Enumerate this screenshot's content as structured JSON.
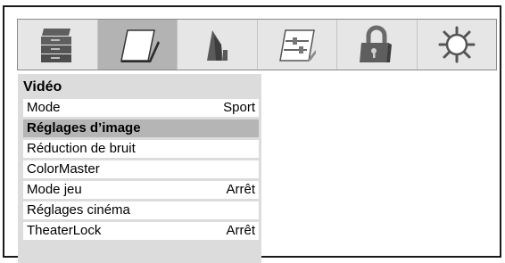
{
  "icon_bar": {
    "icons": [
      {
        "name": "video-settings-icon",
        "selected": false
      },
      {
        "name": "picture-icon",
        "selected": true
      },
      {
        "name": "audio-icon",
        "selected": false
      },
      {
        "name": "preferences-icon",
        "selected": false
      },
      {
        "name": "lock-icon",
        "selected": false
      },
      {
        "name": "setup-icon",
        "selected": false
      }
    ]
  },
  "menu": {
    "title": "Vidéo",
    "items": [
      {
        "label": "Mode",
        "value": "Sport"
      },
      {
        "label": "Réglages d’image",
        "value": ""
      },
      {
        "label": "Réduction de bruit",
        "value": ""
      },
      {
        "label": "ColorMaster",
        "value": ""
      },
      {
        "label": "Mode jeu",
        "value": "Arrêt"
      },
      {
        "label": "Réglages cinéma",
        "value": ""
      },
      {
        "label": "TheaterLock",
        "value": "Arrêt"
      }
    ],
    "highlighted_index": 1
  },
  "colors": {
    "icon_dark": "#5a5a5a",
    "icon_light": "#9a9a9a",
    "selected_bg": "#b3b3b3",
    "highlight_bg": "#b5b5b5"
  }
}
